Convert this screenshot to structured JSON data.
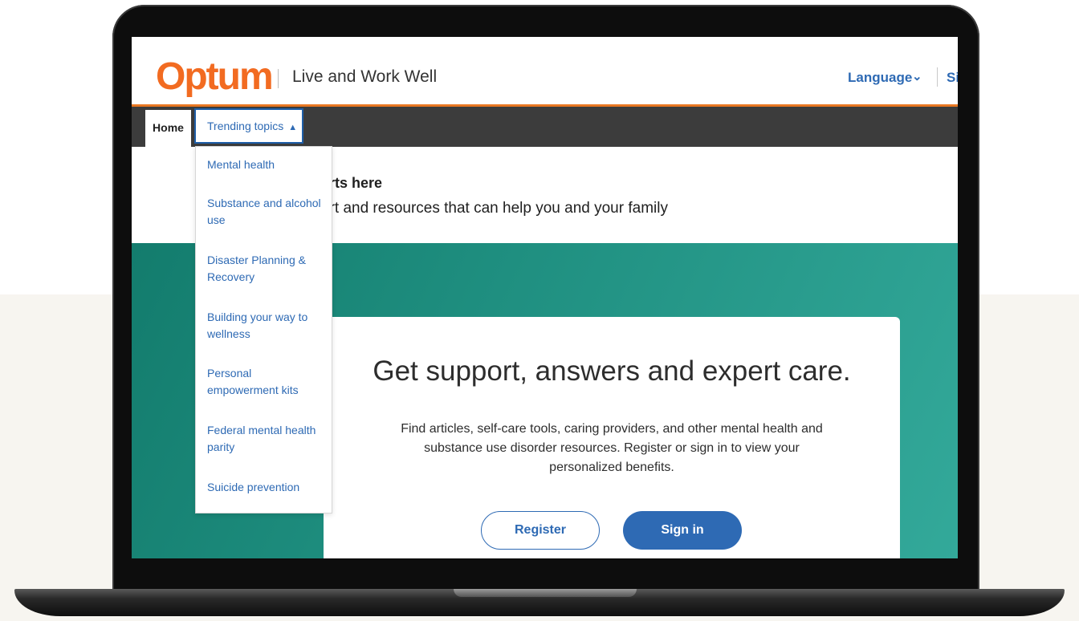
{
  "header": {
    "logo": "Optum",
    "site_name": "Live and Work Well",
    "language_label": "Language",
    "signin_label": "Si"
  },
  "nav": {
    "home": "Home",
    "trending": "Trending topics"
  },
  "dropdown": {
    "items": [
      "Mental health",
      "Substance and alcohol use",
      "Disaster Planning & Recovery",
      "Building your way to wellness",
      "Personal empowerment kits",
      "Federal mental health parity",
      "Suicide prevention"
    ]
  },
  "intro": {
    "title_visible": "arts here",
    "subtitle_visible": "ort and resources that can help you and your family"
  },
  "hero": {
    "title": "Get support, answers and expert care.",
    "body": "Find articles, self-care tools, caring providers, and other mental health and substance use disorder resources. Register or sign in to view your personalized benefits.",
    "register": "Register",
    "signin": "Sign in"
  },
  "icons": {
    "language_chevron": "chevron-down-icon",
    "trending_chevron": "chevron-up-icon"
  },
  "colors": {
    "brand_orange": "#f26b21",
    "link_blue": "#2e6ab4",
    "nav_dark": "#3c3c3c",
    "hero_teal": "#1f8f80"
  }
}
